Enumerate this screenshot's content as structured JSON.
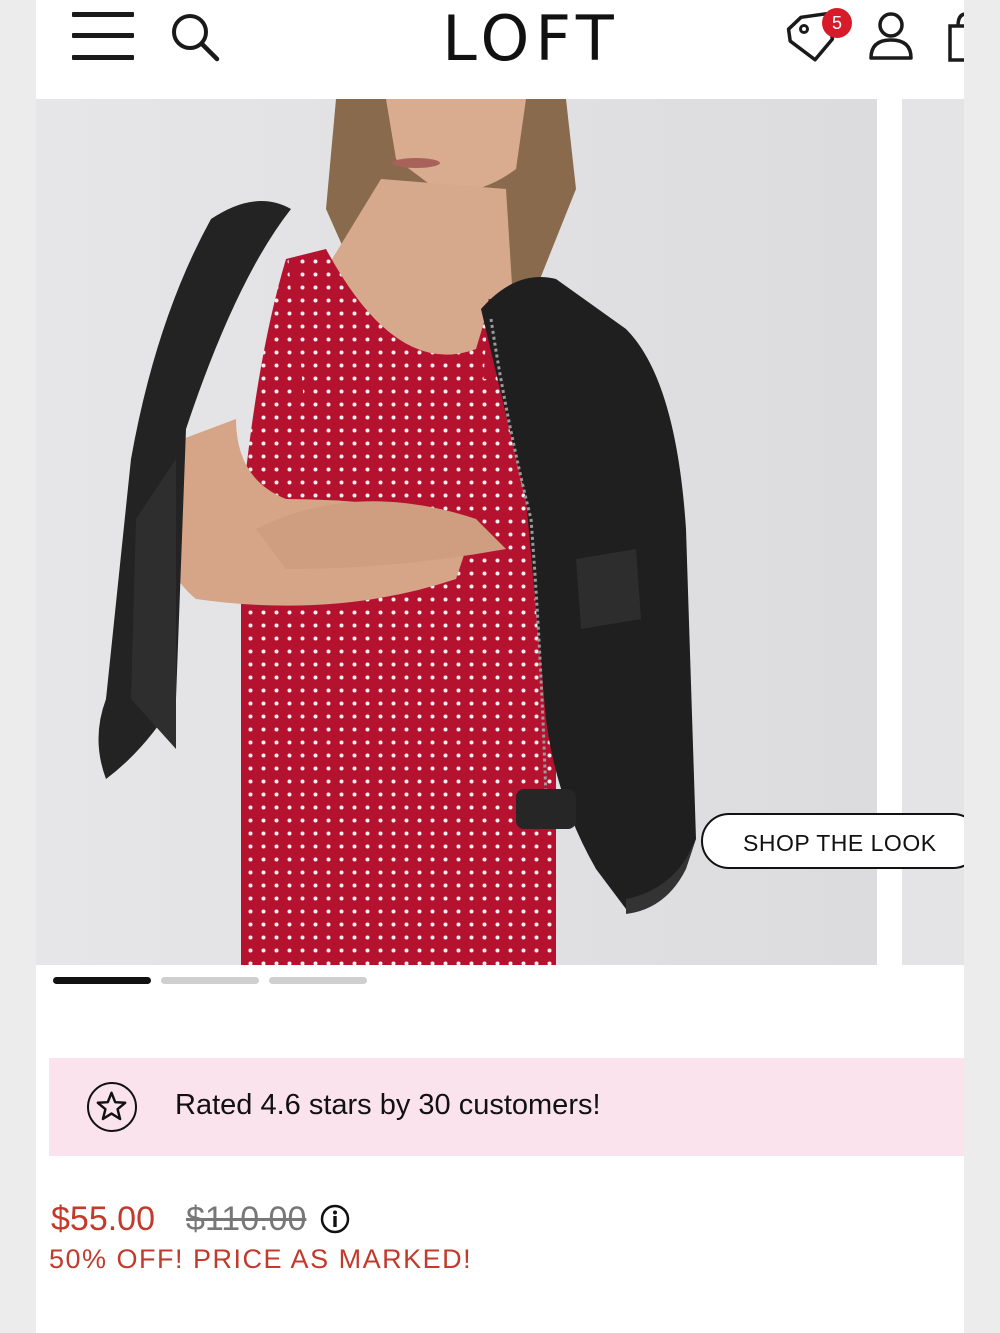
{
  "header": {
    "logo": "LOFT",
    "cart_badge": "5"
  },
  "hero": {
    "shop_the_look": "SHOP THE LOOK",
    "carousel_count": 3,
    "carousel_active": 0
  },
  "rating": {
    "text": "Rated 4.6 stars by 30 customers!"
  },
  "price": {
    "sale": "$55.00",
    "original": "$110.00",
    "promo": "50% OFF! PRICE AS MARKED!"
  },
  "colors": {
    "accent_red": "#c23a2c",
    "badge_red": "#d81b2a",
    "rating_bg": "#fbe3ee",
    "dress_red": "#b5122f"
  }
}
